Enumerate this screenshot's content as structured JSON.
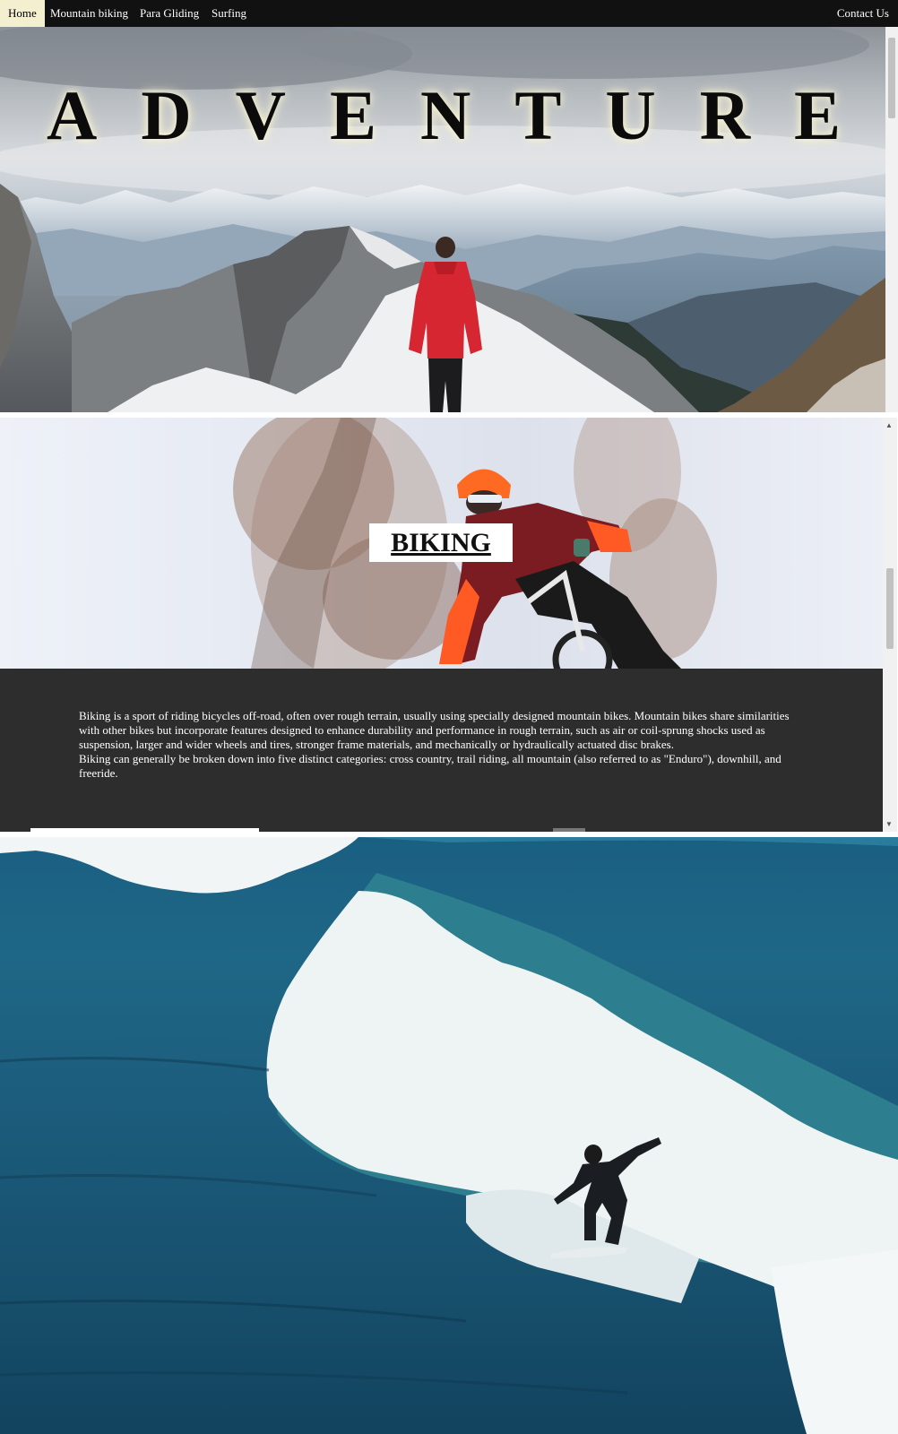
{
  "nav": {
    "items": [
      "Home",
      "Mountain biking",
      "Para Gliding",
      "Surfing"
    ],
    "contact": "Contact Us"
  },
  "hero": {
    "title": "ADVENTURE"
  },
  "biking": {
    "label": "BIKING",
    "paragraph1": "Biking is a sport of riding bicycles off-road, often over rough terrain, usually using specially designed mountain bikes. Mountain bikes share similarities with other bikes but incorporate features designed to enhance durability and performance in rough terrain, such as air or coil-sprung shocks used as suspension, larger and wider wheels and tires, stronger frame materials, and mechanically or hydraulically actuated disc brakes.",
    "paragraph2": "Biking can generally be broken down into five distinct categories: cross country, trail riding, all mountain (also referred to as \"Enduro\"), downhill, and freeride."
  },
  "colors": {
    "nav_bg": "#111111",
    "nav_active_bg": "#f4efcf",
    "text_panel_bg": "#2d2d2d",
    "jacket_red": "#d62631"
  }
}
